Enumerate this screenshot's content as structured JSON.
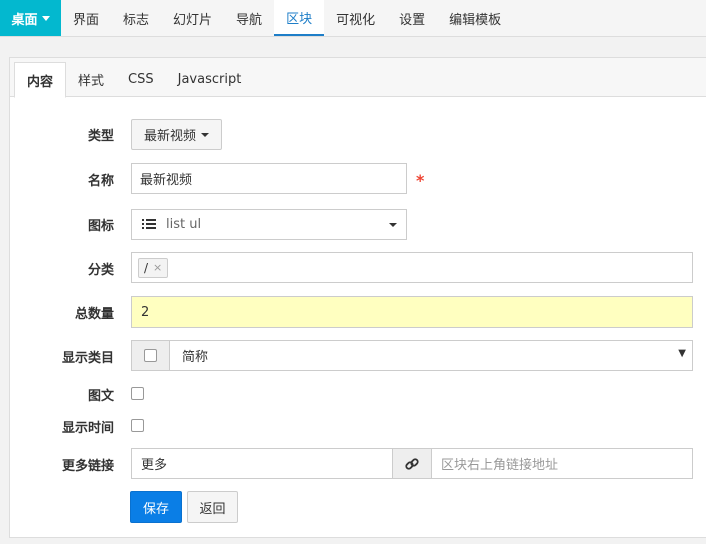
{
  "topnav": {
    "brand": "桌面",
    "items": [
      "界面",
      "标志",
      "幻灯片",
      "导航",
      "区块",
      "可视化",
      "设置",
      "编辑模板"
    ],
    "active_index": 4
  },
  "tabs": [
    "内容",
    "样式",
    "CSS",
    "Javascript"
  ],
  "form": {
    "type": {
      "label": "类型",
      "value": "最新视频"
    },
    "name": {
      "label": "名称",
      "value": "最新视频",
      "required_mark": "*"
    },
    "icon": {
      "label": "图标",
      "value": "list ul",
      "icon_name": "list-ul-icon"
    },
    "category": {
      "label": "分类",
      "tag": "/",
      "tag_remove": "×"
    },
    "total": {
      "label": "总数量",
      "value": "2",
      "highlight_color": "#ffffc0"
    },
    "show_category": {
      "label": "显示类目",
      "select_value": "简称"
    },
    "image_text": {
      "label": "图文"
    },
    "show_time": {
      "label": "显示时间"
    },
    "more_link": {
      "label": "更多链接",
      "text_value": "更多",
      "url_placeholder": "区块右上角链接地址"
    }
  },
  "buttons": {
    "save": "保存",
    "back": "返回"
  },
  "colors": {
    "brand": "#03b8cf",
    "primary": "#0a7ee6",
    "accent_link": "#1e7ec8"
  }
}
